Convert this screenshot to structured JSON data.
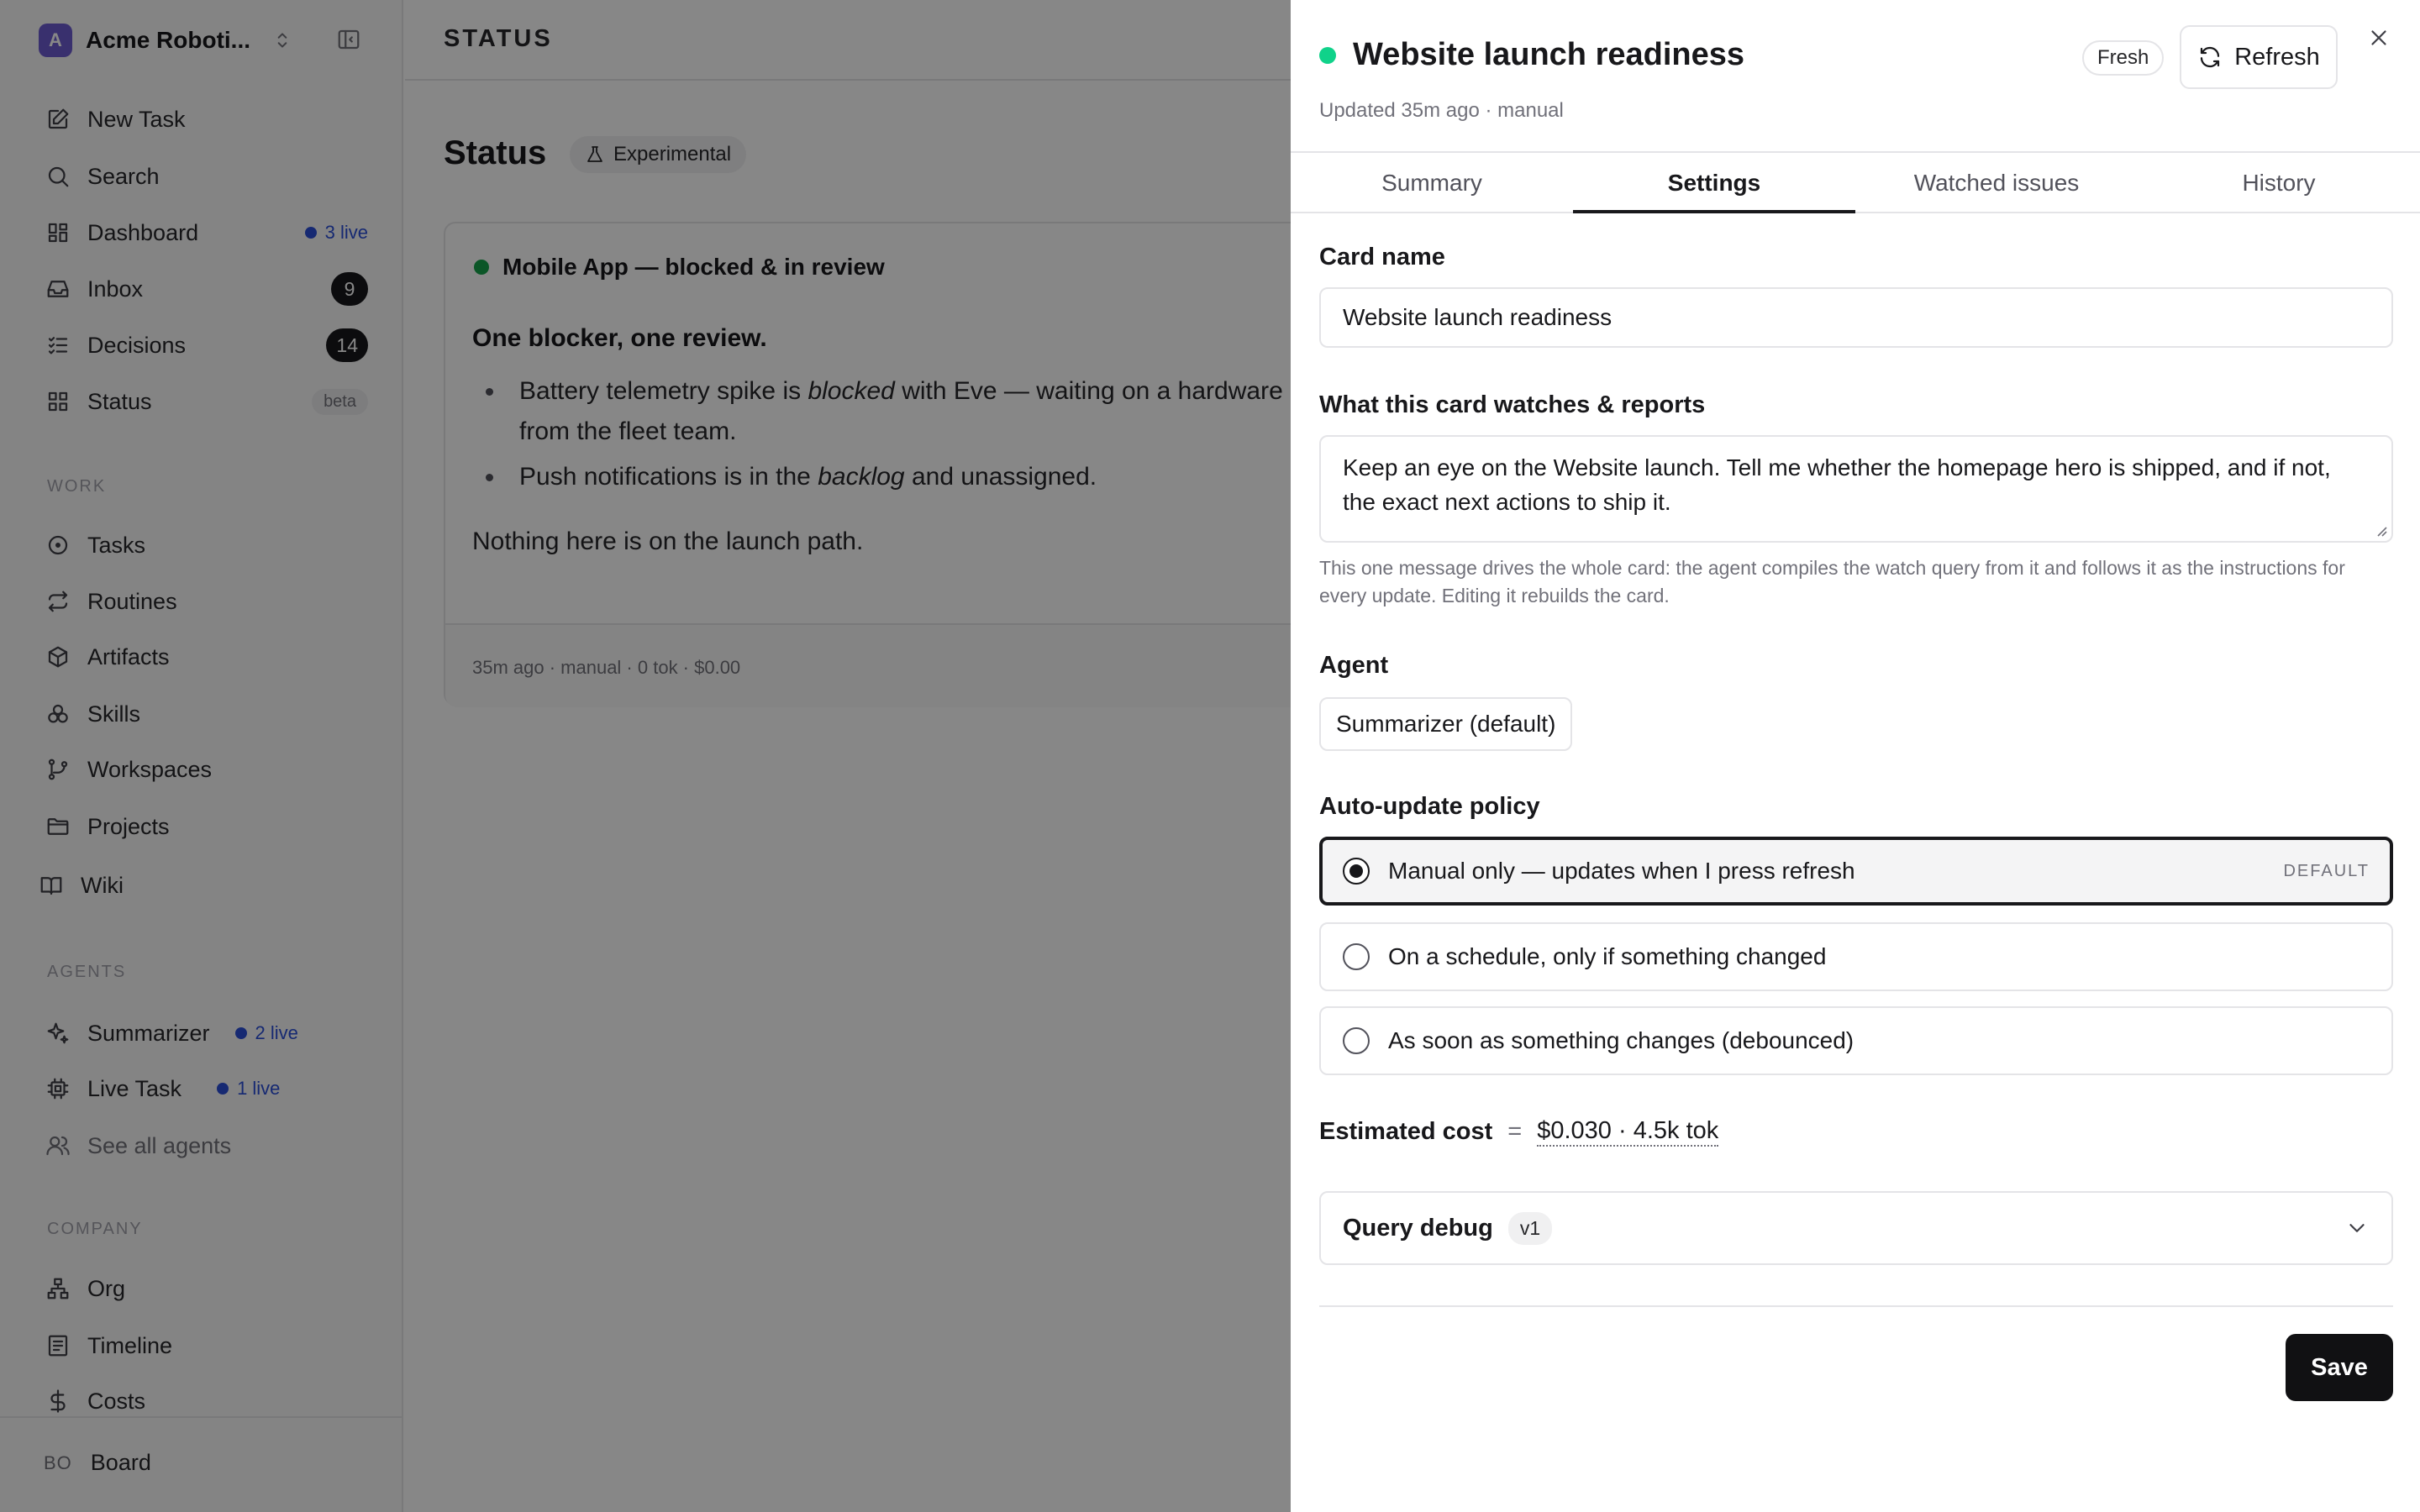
{
  "workspace": {
    "logo_letter": "A",
    "name": "Acme Roboti..."
  },
  "nav": {
    "new_task": "New Task",
    "search": "Search",
    "dashboard": {
      "label": "Dashboard",
      "live": "3 live"
    },
    "inbox": {
      "label": "Inbox",
      "count": "9"
    },
    "decisions": {
      "label": "Decisions",
      "count": "14"
    },
    "status": {
      "label": "Status",
      "badge": "beta"
    }
  },
  "sections": {
    "work": "WORK",
    "agents": "AGENTS",
    "company": "COMPANY"
  },
  "work": [
    "Tasks",
    "Routines",
    "Artifacts",
    "Skills",
    "Workspaces",
    "Projects",
    "Wiki"
  ],
  "agents": {
    "summarizer": {
      "label": "Summarizer",
      "live": "2 live"
    },
    "live_task": {
      "label": "Live Task",
      "live": "1 live"
    },
    "see_all": "See all agents"
  },
  "company": [
    "Org",
    "Timeline",
    "Costs"
  ],
  "user": {
    "initials": "BO",
    "name": "Board"
  },
  "main": {
    "breadcrumb": "STATUS",
    "title": "Status",
    "badge": "Experimental",
    "card": {
      "title": "Mobile App — blocked & in review",
      "lead": "One blocker, one review.",
      "b1_pre": "Battery telemetry spike is ",
      "b1_em": "blocked",
      "b1_post": " with Eve — waiting on a hardware",
      "b1_line2": "from the fleet team.",
      "b2_pre": "Push notifications is in the ",
      "b2_em": "backlog",
      "b2_post": " and unassigned.",
      "footer_text": "Nothing here is on the launch path.",
      "meta": "35m ago · manual · 0 tok · $0.00"
    }
  },
  "drawer": {
    "title": "Website launch readiness",
    "subtitle": "Updated 35m ago · manual",
    "fresh": "Fresh",
    "refresh": "Refresh",
    "tabs": [
      "Summary",
      "Settings",
      "Watched issues",
      "History"
    ],
    "card_name_label": "Card name",
    "card_name_value": "Website launch readiness",
    "watch_label": "What this card watches & reports",
    "watch_text": "Keep an eye on the Website launch. Tell me whether the homepage hero is shipped, and if not, the exact next actions to ship it.",
    "help_text": "This one message drives the whole card: the agent compiles the watch query from it and follows it as the instructions for every update. Editing it rebuilds the card.",
    "agent_label": "Agent",
    "agent_value": "Summarizer (default)",
    "policy_label": "Auto-update policy",
    "policy_options": [
      "Manual only — updates when I press refresh",
      "On a schedule, only if something changed",
      "As soon as something changes (debounced)"
    ],
    "policy_default_tag": "DEFAULT",
    "cost_label": "Estimated cost",
    "cost_eq": "=",
    "cost_value": "$0.030 · 4.5k tok",
    "debug_label": "Query debug",
    "debug_version": "v1",
    "save": "Save"
  },
  "colors": {
    "accent": "#2b4fd8",
    "fresh_dot": "#10d28a",
    "card_dot": "#16a34a",
    "logo": "#6d5bd0"
  }
}
